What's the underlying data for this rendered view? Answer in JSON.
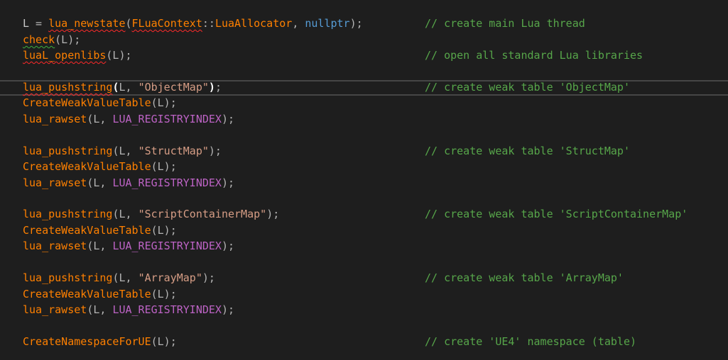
{
  "colors": {
    "background": "#1e1e1e",
    "function": "#ff8000",
    "keyword": "#569cd6",
    "macro": "#bd63c5",
    "string": "#d69d85",
    "comment": "#57a64a",
    "error_squiggle": "#ff2a2a",
    "current_line_border": "#464646"
  },
  "code": {
    "l1": {
      "var": "L",
      "assign": " = ",
      "fn": "lua_newstate",
      "open": "(",
      "cls": "FLuaContext",
      "scope": "::",
      "member": "LuaAllocator",
      "comma": ", ",
      "kw": "nullptr",
      "close": ");"
    },
    "l1_comment": "// create main Lua thread",
    "l2": {
      "fn": "check",
      "args": "(L);"
    },
    "l3": {
      "fn": "luaL_openlibs",
      "args": "(L);"
    },
    "l3_comment": "// open all standard Lua libraries",
    "l5": {
      "fn": "lua_pushstring",
      "open": "(",
      "arg": "L, ",
      "str": "\"ObjectMap\"",
      "close": ")",
      "semi": ";"
    },
    "l5_comment": "// create weak table 'ObjectMap'",
    "l6": {
      "fn": "CreateWeakValueTable",
      "args": "(L);"
    },
    "l7": {
      "fn": "lua_rawset",
      "open": "(L, ",
      "macro": "LUA_REGISTRYINDEX",
      "close": ");"
    },
    "l9": {
      "fn": "lua_pushstring",
      "open": "(L, ",
      "str": "\"StructMap\"",
      "close": ");"
    },
    "l9_comment": "// create weak table 'StructMap'",
    "l10": {
      "fn": "CreateWeakValueTable",
      "args": "(L);"
    },
    "l11": {
      "fn": "lua_rawset",
      "open": "(L, ",
      "macro": "LUA_REGISTRYINDEX",
      "close": ");"
    },
    "l13": {
      "fn": "lua_pushstring",
      "open": "(L, ",
      "str": "\"ScriptContainerMap\"",
      "close": ");"
    },
    "l13_comment": "// create weak table 'ScriptContainerMap'",
    "l14": {
      "fn": "CreateWeakValueTable",
      "args": "(L);"
    },
    "l15": {
      "fn": "lua_rawset",
      "open": "(L, ",
      "macro": "LUA_REGISTRYINDEX",
      "close": ");"
    },
    "l17": {
      "fn": "lua_pushstring",
      "open": "(L, ",
      "str": "\"ArrayMap\"",
      "close": ");"
    },
    "l17_comment": "// create weak table 'ArrayMap'",
    "l18": {
      "fn": "CreateWeakValueTable",
      "args": "(L);"
    },
    "l19": {
      "fn": "lua_rawset",
      "open": "(L, ",
      "macro": "LUA_REGISTRYINDEX",
      "close": ");"
    },
    "l21": {
      "fn": "CreateNamespaceForUE",
      "args": "(L);"
    },
    "l21_comment": "// create 'UE4' namespace (table)"
  }
}
